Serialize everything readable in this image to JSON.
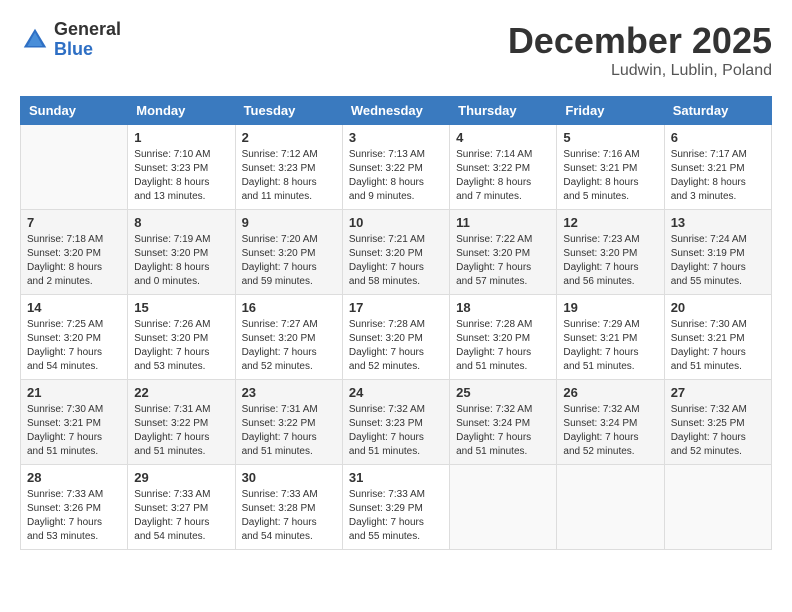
{
  "header": {
    "logo_general": "General",
    "logo_blue": "Blue",
    "month_title": "December 2025",
    "location": "Ludwin, Lublin, Poland"
  },
  "days_of_week": [
    "Sunday",
    "Monday",
    "Tuesday",
    "Wednesday",
    "Thursday",
    "Friday",
    "Saturday"
  ],
  "weeks": [
    [
      {
        "day": "",
        "sunrise": "",
        "sunset": "",
        "daylight": ""
      },
      {
        "day": "1",
        "sunrise": "Sunrise: 7:10 AM",
        "sunset": "Sunset: 3:23 PM",
        "daylight": "Daylight: 8 hours and 13 minutes."
      },
      {
        "day": "2",
        "sunrise": "Sunrise: 7:12 AM",
        "sunset": "Sunset: 3:23 PM",
        "daylight": "Daylight: 8 hours and 11 minutes."
      },
      {
        "day": "3",
        "sunrise": "Sunrise: 7:13 AM",
        "sunset": "Sunset: 3:22 PM",
        "daylight": "Daylight: 8 hours and 9 minutes."
      },
      {
        "day": "4",
        "sunrise": "Sunrise: 7:14 AM",
        "sunset": "Sunset: 3:22 PM",
        "daylight": "Daylight: 8 hours and 7 minutes."
      },
      {
        "day": "5",
        "sunrise": "Sunrise: 7:16 AM",
        "sunset": "Sunset: 3:21 PM",
        "daylight": "Daylight: 8 hours and 5 minutes."
      },
      {
        "day": "6",
        "sunrise": "Sunrise: 7:17 AM",
        "sunset": "Sunset: 3:21 PM",
        "daylight": "Daylight: 8 hours and 3 minutes."
      }
    ],
    [
      {
        "day": "7",
        "sunrise": "Sunrise: 7:18 AM",
        "sunset": "Sunset: 3:20 PM",
        "daylight": "Daylight: 8 hours and 2 minutes."
      },
      {
        "day": "8",
        "sunrise": "Sunrise: 7:19 AM",
        "sunset": "Sunset: 3:20 PM",
        "daylight": "Daylight: 8 hours and 0 minutes."
      },
      {
        "day": "9",
        "sunrise": "Sunrise: 7:20 AM",
        "sunset": "Sunset: 3:20 PM",
        "daylight": "Daylight: 7 hours and 59 minutes."
      },
      {
        "day": "10",
        "sunrise": "Sunrise: 7:21 AM",
        "sunset": "Sunset: 3:20 PM",
        "daylight": "Daylight: 7 hours and 58 minutes."
      },
      {
        "day": "11",
        "sunrise": "Sunrise: 7:22 AM",
        "sunset": "Sunset: 3:20 PM",
        "daylight": "Daylight: 7 hours and 57 minutes."
      },
      {
        "day": "12",
        "sunrise": "Sunrise: 7:23 AM",
        "sunset": "Sunset: 3:20 PM",
        "daylight": "Daylight: 7 hours and 56 minutes."
      },
      {
        "day": "13",
        "sunrise": "Sunrise: 7:24 AM",
        "sunset": "Sunset: 3:19 PM",
        "daylight": "Daylight: 7 hours and 55 minutes."
      }
    ],
    [
      {
        "day": "14",
        "sunrise": "Sunrise: 7:25 AM",
        "sunset": "Sunset: 3:20 PM",
        "daylight": "Daylight: 7 hours and 54 minutes."
      },
      {
        "day": "15",
        "sunrise": "Sunrise: 7:26 AM",
        "sunset": "Sunset: 3:20 PM",
        "daylight": "Daylight: 7 hours and 53 minutes."
      },
      {
        "day": "16",
        "sunrise": "Sunrise: 7:27 AM",
        "sunset": "Sunset: 3:20 PM",
        "daylight": "Daylight: 7 hours and 52 minutes."
      },
      {
        "day": "17",
        "sunrise": "Sunrise: 7:28 AM",
        "sunset": "Sunset: 3:20 PM",
        "daylight": "Daylight: 7 hours and 52 minutes."
      },
      {
        "day": "18",
        "sunrise": "Sunrise: 7:28 AM",
        "sunset": "Sunset: 3:20 PM",
        "daylight": "Daylight: 7 hours and 51 minutes."
      },
      {
        "day": "19",
        "sunrise": "Sunrise: 7:29 AM",
        "sunset": "Sunset: 3:21 PM",
        "daylight": "Daylight: 7 hours and 51 minutes."
      },
      {
        "day": "20",
        "sunrise": "Sunrise: 7:30 AM",
        "sunset": "Sunset: 3:21 PM",
        "daylight": "Daylight: 7 hours and 51 minutes."
      }
    ],
    [
      {
        "day": "21",
        "sunrise": "Sunrise: 7:30 AM",
        "sunset": "Sunset: 3:21 PM",
        "daylight": "Daylight: 7 hours and 51 minutes."
      },
      {
        "day": "22",
        "sunrise": "Sunrise: 7:31 AM",
        "sunset": "Sunset: 3:22 PM",
        "daylight": "Daylight: 7 hours and 51 minutes."
      },
      {
        "day": "23",
        "sunrise": "Sunrise: 7:31 AM",
        "sunset": "Sunset: 3:22 PM",
        "daylight": "Daylight: 7 hours and 51 minutes."
      },
      {
        "day": "24",
        "sunrise": "Sunrise: 7:32 AM",
        "sunset": "Sunset: 3:23 PM",
        "daylight": "Daylight: 7 hours and 51 minutes."
      },
      {
        "day": "25",
        "sunrise": "Sunrise: 7:32 AM",
        "sunset": "Sunset: 3:24 PM",
        "daylight": "Daylight: 7 hours and 51 minutes."
      },
      {
        "day": "26",
        "sunrise": "Sunrise: 7:32 AM",
        "sunset": "Sunset: 3:24 PM",
        "daylight": "Daylight: 7 hours and 52 minutes."
      },
      {
        "day": "27",
        "sunrise": "Sunrise: 7:32 AM",
        "sunset": "Sunset: 3:25 PM",
        "daylight": "Daylight: 7 hours and 52 minutes."
      }
    ],
    [
      {
        "day": "28",
        "sunrise": "Sunrise: 7:33 AM",
        "sunset": "Sunset: 3:26 PM",
        "daylight": "Daylight: 7 hours and 53 minutes."
      },
      {
        "day": "29",
        "sunrise": "Sunrise: 7:33 AM",
        "sunset": "Sunset: 3:27 PM",
        "daylight": "Daylight: 7 hours and 54 minutes."
      },
      {
        "day": "30",
        "sunrise": "Sunrise: 7:33 AM",
        "sunset": "Sunset: 3:28 PM",
        "daylight": "Daylight: 7 hours and 54 minutes."
      },
      {
        "day": "31",
        "sunrise": "Sunrise: 7:33 AM",
        "sunset": "Sunset: 3:29 PM",
        "daylight": "Daylight: 7 hours and 55 minutes."
      },
      {
        "day": "",
        "sunrise": "",
        "sunset": "",
        "daylight": ""
      },
      {
        "day": "",
        "sunrise": "",
        "sunset": "",
        "daylight": ""
      },
      {
        "day": "",
        "sunrise": "",
        "sunset": "",
        "daylight": ""
      }
    ]
  ]
}
